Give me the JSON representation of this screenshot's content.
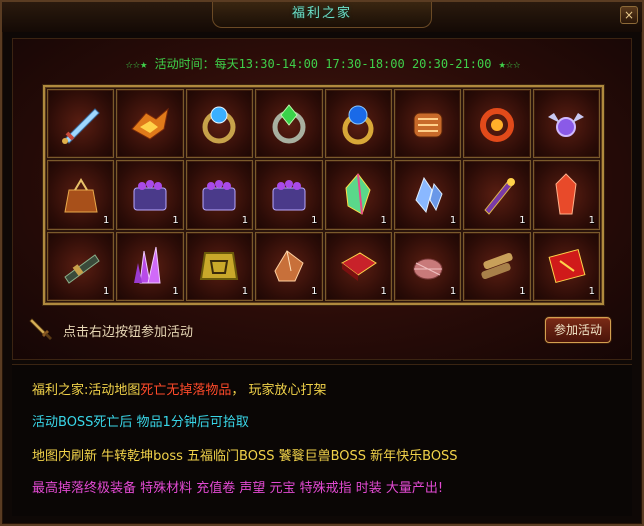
{
  "window": {
    "title": "福利之家",
    "close_label": "×"
  },
  "activity": {
    "stars_left": [
      "☆",
      "☆",
      "★"
    ],
    "time_text": "活动时间：每天13:30-14:00  17:30-18:00  20:30-21:00",
    "stars_right": [
      "★",
      "☆",
      "☆"
    ]
  },
  "items": [
    {
      "name": "sword-icon",
      "count": ""
    },
    {
      "name": "phoenix-armor-icon",
      "count": ""
    },
    {
      "name": "blue-gem-ring-icon",
      "count": ""
    },
    {
      "name": "green-gem-ring-icon",
      "count": ""
    },
    {
      "name": "sapphire-ring-icon",
      "count": ""
    },
    {
      "name": "bracer-icon",
      "count": ""
    },
    {
      "name": "flame-ring-icon",
      "count": ""
    },
    {
      "name": "winged-ring-icon",
      "count": ""
    },
    {
      "name": "gift-pouch-icon",
      "count": "1"
    },
    {
      "name": "purple-chest-icon",
      "count": "1"
    },
    {
      "name": "purple-chest-icon",
      "count": "1"
    },
    {
      "name": "purple-chest-icon",
      "count": "1"
    },
    {
      "name": "rainbow-crystal-icon",
      "count": "1"
    },
    {
      "name": "blue-crystal-icon",
      "count": "1"
    },
    {
      "name": "scroll-tube-icon",
      "count": "1"
    },
    {
      "name": "red-crystal-icon",
      "count": "1"
    },
    {
      "name": "telescope-icon",
      "count": "1"
    },
    {
      "name": "purple-crystal-cluster-icon",
      "count": "1"
    },
    {
      "name": "gold-badge-icon",
      "count": "1"
    },
    {
      "name": "ore-chunk-icon",
      "count": "1"
    },
    {
      "name": "red-book-icon",
      "count": "1"
    },
    {
      "name": "thread-spool-icon",
      "count": "1"
    },
    {
      "name": "wood-bundle-icon",
      "count": "1"
    },
    {
      "name": "red-talisman-icon",
      "count": "1"
    }
  ],
  "hint": {
    "text": "点击右边按钮参加活动",
    "button_label": "参加活动"
  },
  "info": {
    "line1": {
      "a": "福利之家:活动地图",
      "b": "死亡无掉落物品",
      "c": "，  玩家放心打架"
    },
    "line2": "活动BOSS死亡后  物品1分钟后可拾取",
    "line3": "地图内刷新  牛转乾坤boss  五福临门BOSS  饕餮巨兽BOSS  新年快乐BOSS",
    "line4": "最高掉落终极装备  特殊材料  充值卷  声望  元宝  特殊戒指  时装  大量产出!"
  },
  "colors": {
    "accent_gold": "#b08a3e",
    "time_green": "#3fd04a",
    "info_yellow": "#f2d34a",
    "info_red": "#ff4a2a",
    "info_cyan": "#39d6e8",
    "info_magenta": "#e24ad2"
  }
}
